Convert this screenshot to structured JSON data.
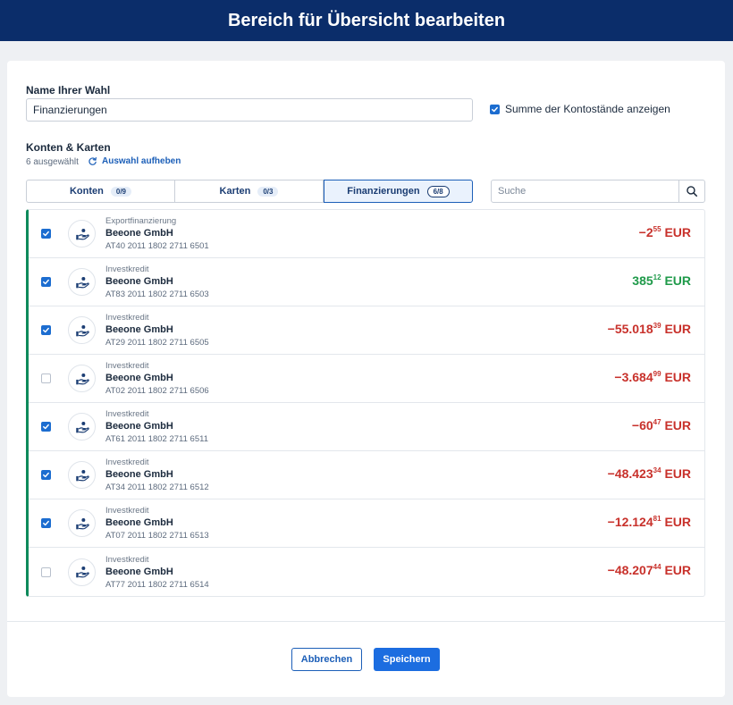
{
  "header": {
    "title": "Bereich für Übersicht bearbeiten"
  },
  "form": {
    "name_label": "Name Ihrer Wahl",
    "name_value": "Finanzierungen",
    "sum_label": "Summe der Kontostände anzeigen",
    "sum_checked": true
  },
  "accounts": {
    "section_label": "Konten & Karten",
    "selected_text": "6 ausgewählt",
    "clear_label": "Auswahl aufheben"
  },
  "tabs": [
    {
      "label": "Konten",
      "badge": "0/9",
      "active": false
    },
    {
      "label": "Karten",
      "badge": "0/3",
      "active": false
    },
    {
      "label": "Finanzierungen",
      "badge": "6/8",
      "active": true
    }
  ],
  "search": {
    "placeholder": "Suche"
  },
  "rows": [
    {
      "checked": true,
      "product": "Exportfinanzierung",
      "owner": "Beeone GmbH",
      "iban": "AT40 2011 1802 2711 6501",
      "sign": "−",
      "int": "2",
      "dec": "55",
      "currency": "EUR",
      "negative": true
    },
    {
      "checked": true,
      "product": "Investkredit",
      "owner": "Beeone GmbH",
      "iban": "AT83 2011 1802 2711 6503",
      "sign": "",
      "int": "385",
      "dec": "12",
      "currency": "EUR",
      "negative": false
    },
    {
      "checked": true,
      "product": "Investkredit",
      "owner": "Beeone GmbH",
      "iban": "AT29 2011 1802 2711 6505",
      "sign": "−",
      "int": "55.018",
      "dec": "39",
      "currency": "EUR",
      "negative": true
    },
    {
      "checked": false,
      "product": "Investkredit",
      "owner": "Beeone GmbH",
      "iban": "AT02 2011 1802 2711 6506",
      "sign": "−",
      "int": "3.684",
      "dec": "99",
      "currency": "EUR",
      "negative": true
    },
    {
      "checked": true,
      "product": "Investkredit",
      "owner": "Beeone GmbH",
      "iban": "AT61 2011 1802 2711 6511",
      "sign": "−",
      "int": "60",
      "dec": "47",
      "currency": "EUR",
      "negative": true
    },
    {
      "checked": true,
      "product": "Investkredit",
      "owner": "Beeone GmbH",
      "iban": "AT34 2011 1802 2711 6512",
      "sign": "−",
      "int": "48.423",
      "dec": "34",
      "currency": "EUR",
      "negative": true
    },
    {
      "checked": true,
      "product": "Investkredit",
      "owner": "Beeone GmbH",
      "iban": "AT07 2011 1802 2711 6513",
      "sign": "−",
      "int": "12.124",
      "dec": "81",
      "currency": "EUR",
      "negative": true
    },
    {
      "checked": false,
      "product": "Investkredit",
      "owner": "Beeone GmbH",
      "iban": "AT77 2011 1802 2711 6514",
      "sign": "−",
      "int": "48.207",
      "dec": "44",
      "currency": "EUR",
      "negative": true
    }
  ],
  "actions": {
    "cancel_label": "Abbrechen",
    "save_label": "Speichern"
  },
  "colors": {
    "header": "#0b2d6a",
    "accent": "#1c6dd0",
    "negative": "#c8312b",
    "positive": "#1f9a4a",
    "selection_bar": "#0e8a5b"
  },
  "icons": {
    "check": "check-icon",
    "refresh": "refresh-icon",
    "search": "search-icon",
    "financing": "hand-coin-icon"
  }
}
